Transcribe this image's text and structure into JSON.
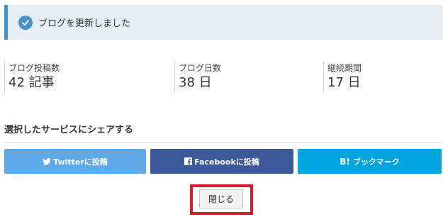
{
  "notice": {
    "message": "ブログを更新しました",
    "icon": "check-circle-icon",
    "accent": "#4a90c8"
  },
  "stats": [
    {
      "label": "ブログ投稿数",
      "value": "42 記事"
    },
    {
      "label": "ブログ日数",
      "value": "38 日"
    },
    {
      "label": "継続期間",
      "value": "17 日"
    }
  ],
  "share": {
    "title": "選択したサービスにシェアする",
    "buttons": [
      {
        "label": "Twitterに投稿",
        "icon": "twitter-bird-icon",
        "color": "#5ea9e8"
      },
      {
        "label": "Facebookに投稿",
        "icon": "facebook-icon",
        "color": "#3b5898"
      },
      {
        "label": "ブックマーク",
        "icon_text": "B!",
        "icon": "hatena-bookmark-icon",
        "color": "#00a4de"
      }
    ]
  },
  "close": {
    "label": "閉じる",
    "highlight_color": "#d0202a"
  }
}
